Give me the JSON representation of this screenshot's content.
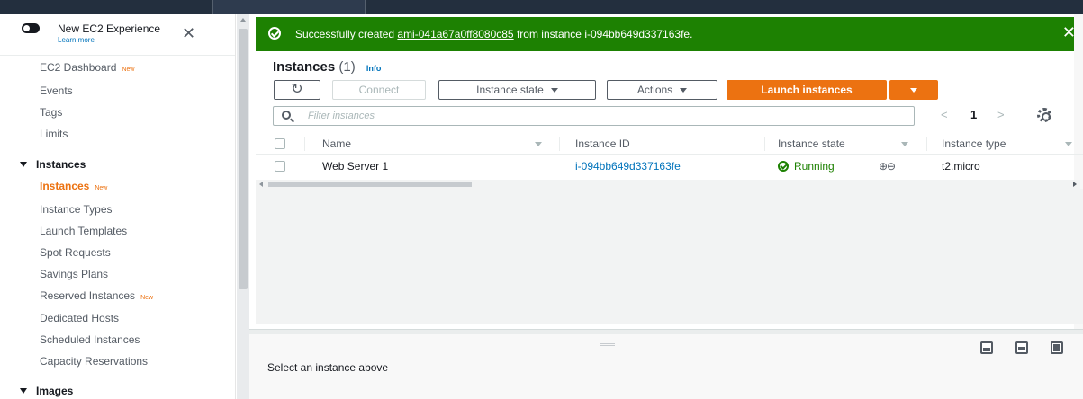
{
  "sidebar": {
    "new_experience_label": "New EC2 Experience",
    "learn_more": "Learn more",
    "close_glyph": "✕",
    "new_badge": "New",
    "items_top": [
      {
        "label": "EC2 Dashboard",
        "badge": "New"
      },
      {
        "label": "Events",
        "badge": ""
      },
      {
        "label": "Tags",
        "badge": ""
      },
      {
        "label": "Limits",
        "badge": ""
      }
    ],
    "section_instances": "Instances",
    "instances_items": [
      {
        "label": "Instances",
        "badge": "New",
        "active": true
      },
      {
        "label": "Instance Types",
        "badge": ""
      },
      {
        "label": "Launch Templates",
        "badge": ""
      },
      {
        "label": "Spot Requests",
        "badge": ""
      },
      {
        "label": "Savings Plans",
        "badge": ""
      },
      {
        "label": "Reserved Instances",
        "badge": "New"
      },
      {
        "label": "Dedicated Hosts",
        "badge": ""
      },
      {
        "label": "Scheduled Instances",
        "badge": ""
      },
      {
        "label": "Capacity Reservations",
        "badge": ""
      }
    ],
    "section_images": "Images"
  },
  "banner": {
    "prefix": "Successfully created ",
    "ami_link": "ami-041a67a0ff8080c85",
    "middle": " from instance ",
    "instance": "i-094bb649d337163fe.",
    "close_glyph": "✕",
    "color": "#1d8102"
  },
  "instances_panel": {
    "title": "Instances",
    "count": "(1)",
    "info": "Info",
    "refresh_glyph": "↻",
    "connect": "Connect",
    "instance_state": "Instance state",
    "actions": "Actions",
    "launch": "Launch instances",
    "filter_placeholder": "Filter instances",
    "page_prev": "<",
    "page_num": "1",
    "page_next": ">"
  },
  "table": {
    "columns": [
      "Name",
      "Instance ID",
      "Instance state",
      "Instance type"
    ],
    "rows": [
      {
        "name": "Web Server 1",
        "instance_id": "i-094bb649d337163fe",
        "state": "Running",
        "type": "t2.micro"
      }
    ],
    "zoom_glyphs": "⊕⊖"
  },
  "bottom_panel": {
    "message": "Select an instance above"
  },
  "colors": {
    "accent_orange": "#ec7211",
    "link_blue": "#0073bb",
    "success_green": "#1d8102"
  }
}
